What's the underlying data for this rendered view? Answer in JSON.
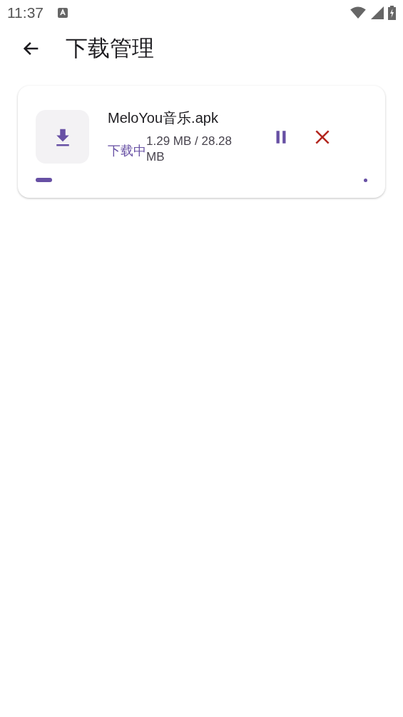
{
  "status_bar": {
    "time": "11:37"
  },
  "app_bar": {
    "title": "下载管理"
  },
  "downloads": [
    {
      "file_name": "MeloYou音乐.apk",
      "status": "下载中",
      "size": "1.29 MB / 28.28 MB",
      "paused": false,
      "level": 0.05
    }
  ]
}
